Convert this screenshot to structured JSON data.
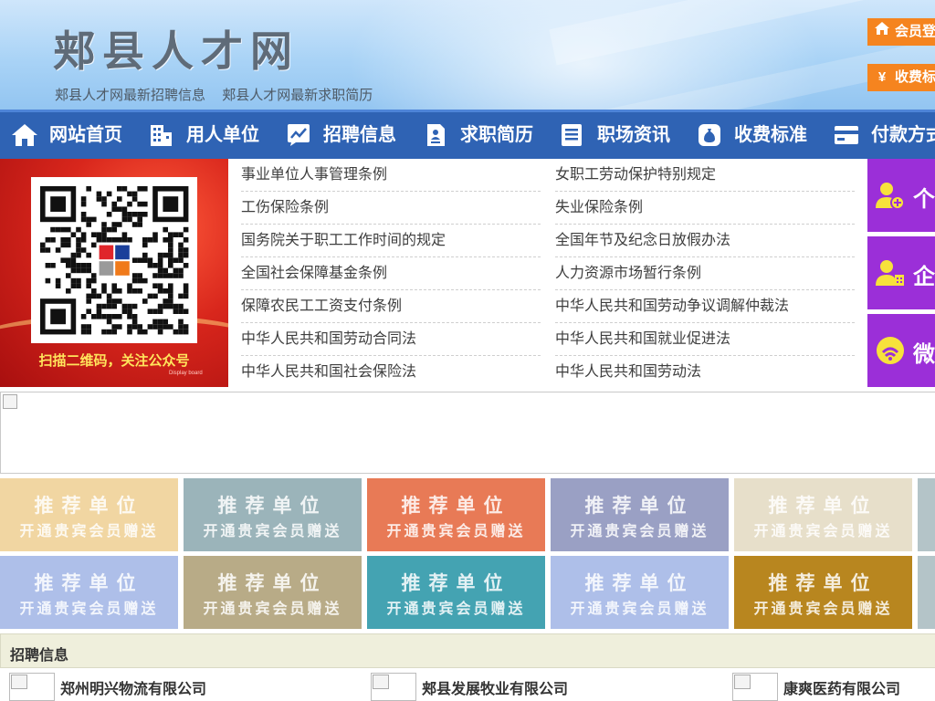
{
  "header": {
    "site_title": "郏县人才网",
    "sub_links": [
      "郏县人才网最新招聘信息",
      "郏县人才网最新求职简历"
    ],
    "login_button": "会员登",
    "fee_button": "收费标"
  },
  "nav": {
    "items": [
      {
        "label": "网站首页",
        "icon": "home-icon"
      },
      {
        "label": "用人单位",
        "icon": "building-icon"
      },
      {
        "label": "招聘信息",
        "icon": "chart-icon"
      },
      {
        "label": "求职简历",
        "icon": "resume-icon"
      },
      {
        "label": "职场资讯",
        "icon": "news-icon"
      },
      {
        "label": "收费标准",
        "icon": "money-bag-icon"
      },
      {
        "label": "付款方式",
        "icon": "card-icon"
      }
    ]
  },
  "qr": {
    "caption": "扫描二维码，关注公众号",
    "small_text": "Display board"
  },
  "laws": {
    "left": [
      "事业单位人事管理条例",
      "工伤保险条例",
      "国务院关于职工工作时间的规定",
      "全国社会保障基金条例",
      "保障农民工工资支付条例",
      "中华人民共和国劳动合同法",
      "中华人民共和国社会保险法"
    ],
    "right": [
      "女职工劳动保护特别规定",
      "失业保险条例",
      "全国年节及纪念日放假办法",
      "人力资源市场暂行条例",
      "中华人民共和国劳动争议调解仲裁法",
      "中华人民共和国就业促进法",
      "中华人民共和国劳动法"
    ]
  },
  "side_buttons": [
    {
      "label": "个",
      "icon": "person-add-icon"
    },
    {
      "label": "企",
      "icon": "company-user-icon"
    },
    {
      "label": "微",
      "icon": "wechat-icon"
    }
  ],
  "tiles": {
    "line1": "推荐单位",
    "line2": "开通贵宾会员赠送",
    "colors_row1": [
      "#f1d6a2",
      "#9bb4ba",
      "#e87a56",
      "#9aa0c4",
      "#e7dfca",
      "#b4c4c8"
    ],
    "colors_row2": [
      "#aebfe9",
      "#b8ab87",
      "#44a3b2",
      "#aebfe9",
      "#b8861f",
      "#b4c4c8"
    ]
  },
  "jobs": {
    "title": "招聘信息",
    "companies": [
      "郑州明兴物流有限公司",
      "郏县发展牧业有限公司",
      "康爽医药有限公司"
    ]
  }
}
